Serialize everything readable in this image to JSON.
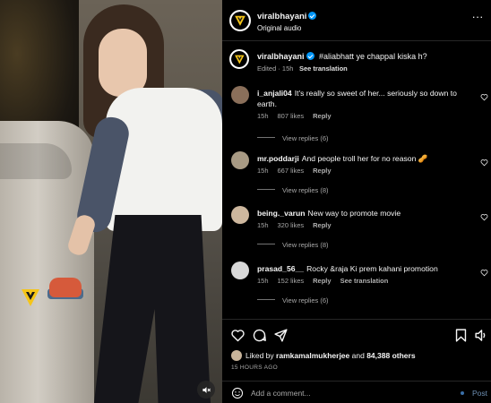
{
  "media": {
    "mute_icon": "speaker-muted-icon",
    "watermark_icon": "viralbhayani-logo"
  },
  "header": {
    "username": "viralbhayani",
    "audio": "Original audio",
    "more_icon": "more-horizontal-icon"
  },
  "caption": {
    "username": "viralbhayani",
    "text": "#aliabhatt ye chappal kiska h?",
    "meta": "Edited · 15h",
    "translate": "See translation"
  },
  "comments": [
    {
      "username": "i_anjali04",
      "text": "It's really so sweet of her... seriously so down to earth.",
      "time": "15h",
      "likes": "807 likes",
      "reply": "Reply",
      "translate": "",
      "view_replies": "View replies (6)",
      "avatar_color": "#8a6f5a"
    },
    {
      "username": "mr.poddarji",
      "text": "And people troll her for no reason 🥜",
      "time": "15h",
      "likes": "667 likes",
      "reply": "Reply",
      "translate": "",
      "view_replies": "View replies (8)",
      "avatar_color": "#a89a84"
    },
    {
      "username": "being._varun",
      "text": "New way to promote movie",
      "time": "15h",
      "likes": "320 likes",
      "reply": "Reply",
      "translate": "",
      "view_replies": "View replies (8)",
      "avatar_color": "#cdb79e"
    },
    {
      "username": "prasad_56__",
      "text": "Rocky &raja Ki prem kahani promotion",
      "time": "15h",
      "likes": "152 likes",
      "reply": "Reply",
      "translate": "See translation",
      "view_replies": "View replies (6)",
      "avatar_color": "#d9d9d9"
    }
  ],
  "actions": {
    "liked_by_prefix": "Liked by",
    "liked_by_user": "ramkamalmukherjee",
    "liked_by_and": "and",
    "liked_by_count": "84,388 others",
    "timestamp": "15 HOURS AGO",
    "comment_placeholder": "Add a comment...",
    "post_label": "Post"
  },
  "colors": {
    "accent_blue": "#0095f6",
    "brand_yellow": "#f5c518",
    "post_blue": "#6d8fb3"
  }
}
